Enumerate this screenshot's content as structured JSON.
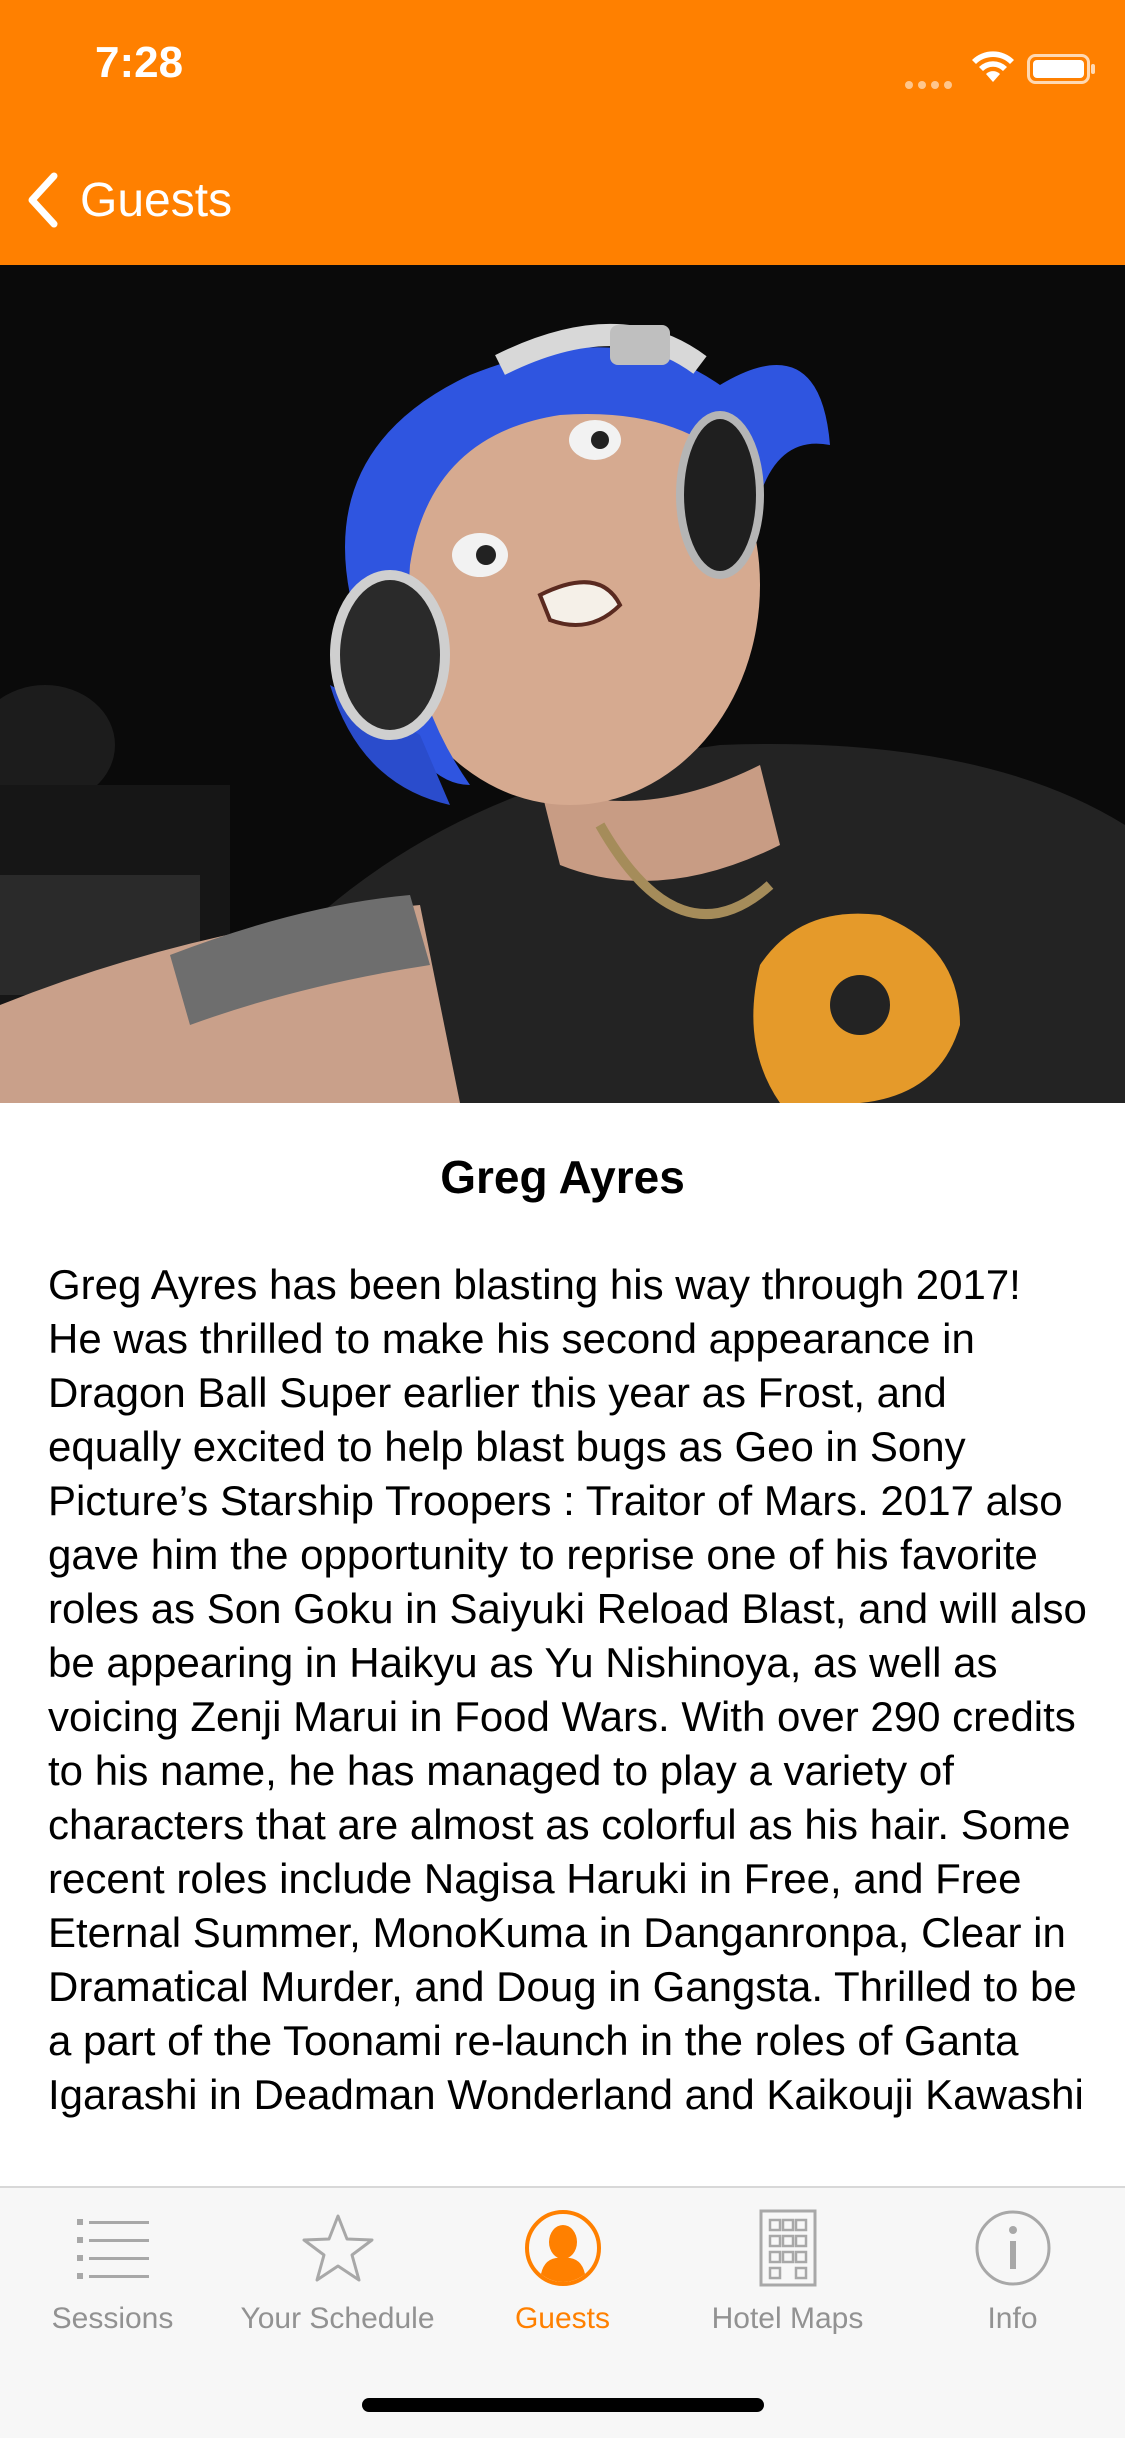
{
  "status_bar": {
    "time": "7:28"
  },
  "nav": {
    "back_label": "Guests"
  },
  "guest": {
    "name": "Greg Ayres",
    "bio": "Greg Ayres has been blasting his way through 2017!  He was thrilled to make his second appearance in Dragon Ball Super earlier this year as Frost, and equally excited to help blast bugs as Geo in Sony Picture’s Starship Troopers : Traitor of Mars. 2017 also gave him the opportunity to reprise one of his favorite roles as Son Goku in Saiyuki Reload Blast, and will also be appearing in Haikyu as Yu Nishinoya, as well as voicing Zenji Marui in Food Wars. With over 290 credits to his name, he has managed to play a variety of characters that are almost as colorful as his hair. Some recent roles include Nagisa Haruki in Free, and Free Eternal Summer, MonoKuma in Danganronpa, Clear in Dramatical Murder, and Doug in Gangsta. Thrilled to be a part of the Toonami re-launch in the roles of Ganta Igarashi in Deadman Wonderland and Kaikouji Kawashi"
  },
  "tabs": [
    {
      "label": "Sessions",
      "icon": "list-icon",
      "active": false
    },
    {
      "label": "Your Schedule",
      "icon": "star-icon",
      "active": false
    },
    {
      "label": "Guests",
      "icon": "person-icon",
      "active": true
    },
    {
      "label": "Hotel Maps",
      "icon": "building-icon",
      "active": false
    },
    {
      "label": "Info",
      "icon": "info-icon",
      "active": false
    }
  ],
  "colors": {
    "accent": "#ff8000",
    "tab_inactive": "#929292",
    "tabbar_bg": "#f7f7f7"
  }
}
